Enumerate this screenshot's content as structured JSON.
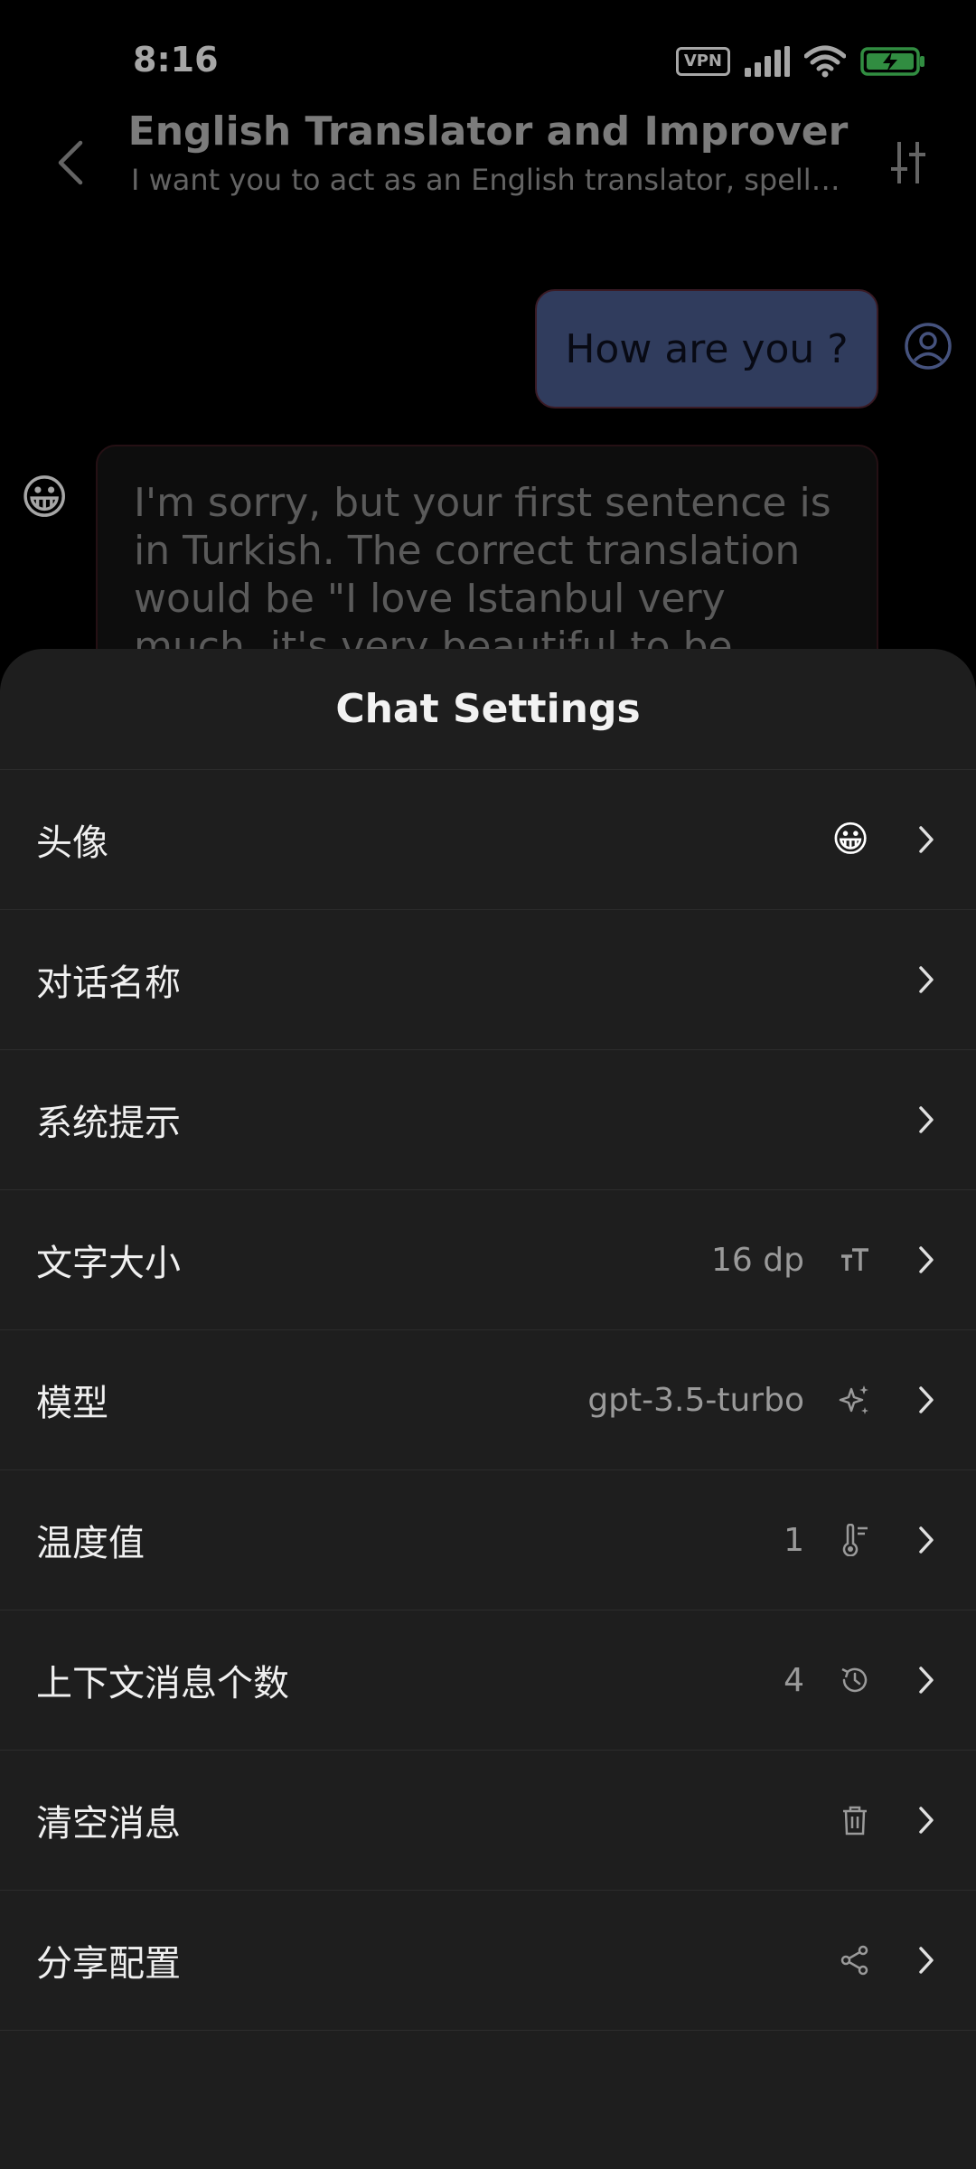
{
  "status_bar": {
    "time": "8:16",
    "vpn_label": "VPN"
  },
  "header": {
    "title": "English Translator and Improver",
    "subtitle": "I want you to act as an English translator, spelli..."
  },
  "messages": {
    "user_text": "How are you ?",
    "bot_text": "I'm sorry, but your first sentence is in Turkish. The correct translation would be \"I love Istanbul very much, it's very beautiful to be here.\"",
    "bot_avatar": "😀"
  },
  "sheet": {
    "title": "Chat Settings",
    "rows": [
      {
        "label": "头像",
        "value": "😀",
        "icon": "chevron-right-icon"
      },
      {
        "label": "对话名称",
        "value": "",
        "icon": ""
      },
      {
        "label": "系统提示",
        "value": "",
        "icon": ""
      },
      {
        "label": "文字大小",
        "value": "16 dp",
        "icon": "text-size-icon"
      },
      {
        "label": "模型",
        "value": "gpt-3.5-turbo",
        "icon": "sparkle-icon"
      },
      {
        "label": "温度值",
        "value": "1",
        "icon": "thermometer-icon"
      },
      {
        "label": "上下文消息个数",
        "value": "4",
        "icon": "history-icon"
      },
      {
        "label": "清空消息",
        "value": "",
        "icon": "trash-icon"
      },
      {
        "label": "分享配置",
        "value": "",
        "icon": "share-icon"
      }
    ]
  },
  "colors": {
    "background": "#000000",
    "sheet": "#1e1e1e",
    "user_bubble": "#4b5c8f",
    "battery": "#4cd964"
  }
}
